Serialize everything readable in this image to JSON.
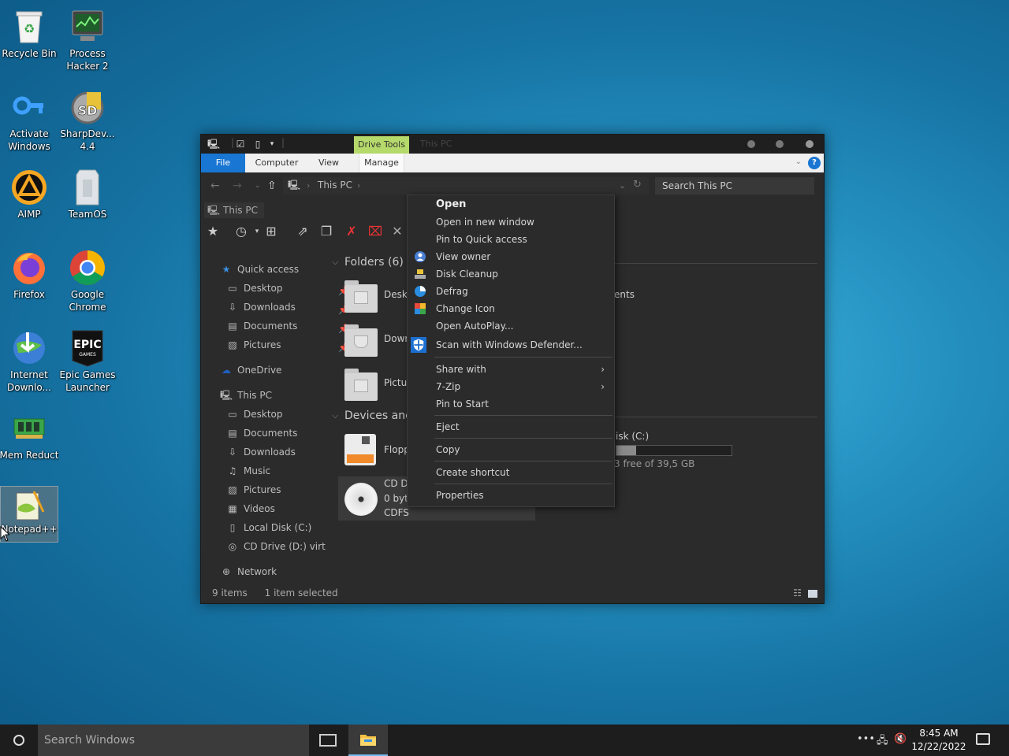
{
  "desktop": {
    "icons": [
      {
        "label": "Recycle Bin"
      },
      {
        "label": "Process Hacker 2"
      },
      {
        "label": "Activate Windows"
      },
      {
        "label": "SharpDev... 4.4"
      },
      {
        "label": "AIMP"
      },
      {
        "label": "TeamOS"
      },
      {
        "label": "Firefox"
      },
      {
        "label": "Google Chrome"
      },
      {
        "label": "Internet Downlo..."
      },
      {
        "label": "Epic Games Launcher"
      },
      {
        "label": "Mem Reduct"
      },
      {
        "label": "Notepad++"
      }
    ]
  },
  "explorer": {
    "drive_tools": "Drive Tools",
    "title": "This PC",
    "ribbon_tabs": [
      "File",
      "Computer",
      "View",
      "Manage"
    ],
    "help": "?",
    "address": "This PC",
    "search_placeholder": "Search This PC",
    "breadcrumb_tab": "This PC",
    "nav": {
      "quick_access": "Quick access",
      "quick_items": [
        "Desktop",
        "Downloads",
        "Documents",
        "Pictures"
      ],
      "onedrive": "OneDrive",
      "this_pc": "This PC",
      "pc_items": [
        "Desktop",
        "Documents",
        "Downloads",
        "Music",
        "Pictures",
        "Videos",
        "Local Disk (C:)",
        "CD Drive (D:) virtio"
      ],
      "network": "Network"
    },
    "content": {
      "folders_header": "Folders (6)",
      "folders": [
        "Desk",
        "Down",
        "Pictu"
      ],
      "right_partial": "ents",
      "devices_header": "Devices anc",
      "floppy": "Flopp",
      "cd_lines": [
        "CD D",
        "0 byt",
        "CDFS"
      ],
      "local_disk_label": "isk (C:)",
      "local_disk_free": "3 free of 39,5 GB",
      "disk_used_fraction": 0.17
    },
    "status": {
      "items": "9 items",
      "selected": "1 item selected"
    }
  },
  "context_menu": {
    "items": [
      {
        "label": "Open",
        "icon": ""
      },
      {
        "label": "Open in new window",
        "icon": ""
      },
      {
        "label": "Pin to Quick access",
        "icon": ""
      },
      {
        "label": "View owner",
        "icon": "user-icon"
      },
      {
        "label": "Disk Cleanup",
        "icon": "disk-cleanup-icon"
      },
      {
        "label": "Defrag",
        "icon": "defrag-icon"
      },
      {
        "label": "Change Icon",
        "icon": "change-icon-icon"
      },
      {
        "label": "Open AutoPlay...",
        "icon": ""
      },
      {
        "label": "Scan with Windows Defender...",
        "icon": "defender-shield-icon"
      },
      {
        "label": "Share with",
        "icon": ""
      },
      {
        "label": "7-Zip",
        "icon": ""
      },
      {
        "label": "Pin to Start",
        "icon": ""
      },
      {
        "label": "Eject",
        "icon": ""
      },
      {
        "label": "Copy",
        "icon": ""
      },
      {
        "label": "Create shortcut",
        "icon": ""
      },
      {
        "label": "Properties",
        "icon": ""
      }
    ]
  },
  "taskbar": {
    "search_placeholder": "Search Windows",
    "time": "8:45 AM",
    "date": "12/22/2022"
  },
  "colors": {
    "accent": "#1976d2",
    "drive_tools": "#b5d96a"
  }
}
